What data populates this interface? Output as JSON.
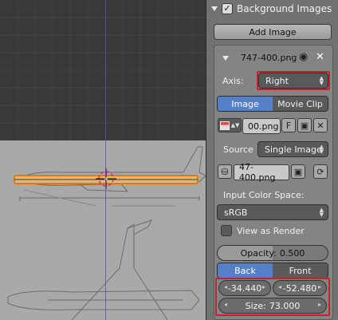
{
  "header": {
    "title": "Background Images",
    "enabled_check": "✓"
  },
  "add_image_label": "Add Image",
  "image_row": {
    "name": "747-400.png",
    "eye": "👁",
    "close": "✕"
  },
  "axis": {
    "label": "Axis:",
    "value": "Right"
  },
  "source_type_tabs": {
    "image": "Image",
    "movie_clip": "Movie Clip"
  },
  "image_block": {
    "name": "00.png",
    "fake_user": "F"
  },
  "source": {
    "label": "Source",
    "value": "Single Image"
  },
  "file": {
    "path": "47-400.png"
  },
  "color_space": {
    "label": "Input Color Space:",
    "value": "sRGB"
  },
  "view_as_render": {
    "label": "View as Render"
  },
  "opacity": {
    "label": "Opacity:",
    "value": "0.500"
  },
  "depth_tabs": {
    "back": "Back",
    "front": "Front"
  },
  "offset": {
    "x": "-34.440",
    "y": "-52.480"
  },
  "size": {
    "label": "Size:",
    "value": "73.000"
  },
  "colors": {
    "accent": "#5580c8",
    "highlight": "#c9202a",
    "panel": "#727272"
  }
}
